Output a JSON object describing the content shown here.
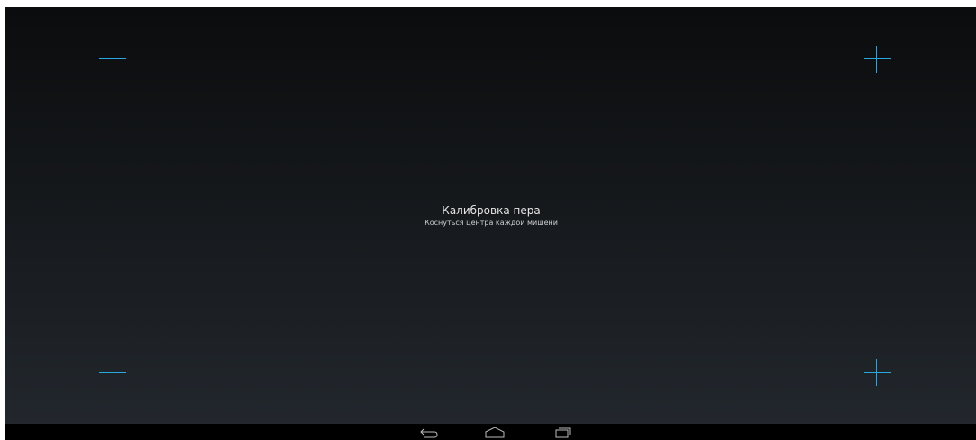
{
  "calibration": {
    "title": "Калибровка пера",
    "instruction": "Коснуться центра каждой мишени",
    "target_color": "#2aa6e0",
    "targets": [
      "top-left",
      "top-right",
      "bottom-left",
      "bottom-right"
    ]
  },
  "navigation_bar": {
    "buttons": [
      "back-icon",
      "home-icon",
      "recents-icon"
    ]
  }
}
